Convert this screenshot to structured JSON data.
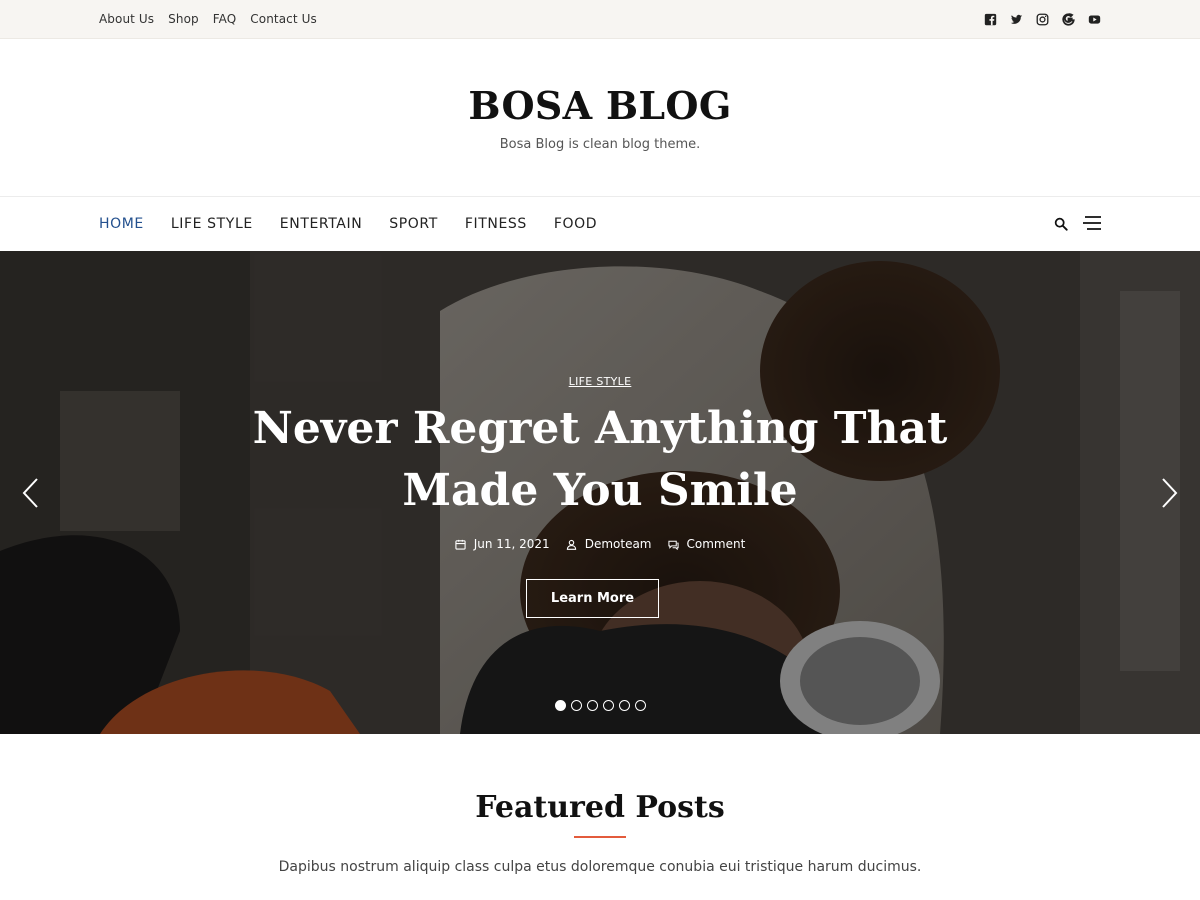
{
  "topbar": {
    "links": [
      "About Us",
      "Shop",
      "FAQ",
      "Contact Us"
    ],
    "social_icons": [
      "facebook-icon",
      "twitter-icon",
      "instagram-icon",
      "google-icon",
      "youtube-icon"
    ]
  },
  "branding": {
    "title": "BOSA BLOG",
    "tagline": "Bosa Blog is clean blog theme."
  },
  "nav": {
    "items": [
      "HOME",
      "LIFE STYLE",
      "ENTERTAIN",
      "SPORT",
      "FITNESS",
      "FOOD"
    ],
    "active_index": 0,
    "active_color": "#23508e",
    "icons": [
      "search-icon",
      "hamburger-menu-icon"
    ]
  },
  "hero": {
    "category": "LIFE STYLE",
    "title": "Never Regret Anything That Made You Smile",
    "meta": {
      "date": "Jun 11, 2021",
      "author": "Demoteam",
      "comment": "Comment"
    },
    "button_label": "Learn More",
    "slide_count": 6,
    "active_slide": 1
  },
  "featured": {
    "title": "Featured Posts",
    "description": "Dapibus nostrum aliquip class culpa etus doloremque conubia eui tristique harum ducimus.",
    "accent_color": "#e35b3c"
  }
}
